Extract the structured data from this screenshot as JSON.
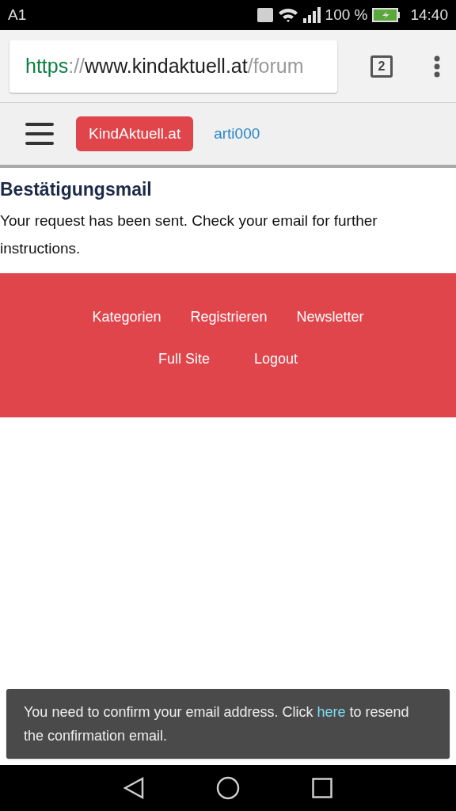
{
  "status_bar": {
    "carrier": "A1",
    "battery": "100 %",
    "time": "14:40"
  },
  "browser": {
    "url": {
      "scheme": "https",
      "separator": "://",
      "host": "www.kindaktuell.at",
      "path": "/forum"
    },
    "tab_count": "2"
  },
  "site_nav": {
    "logo": "KindAktuell.at",
    "user": "arti000"
  },
  "content": {
    "title": "Bestätigungsmail",
    "message": "Your request has been sent. Check your email for further instructions."
  },
  "footer": {
    "rows": [
      [
        "Kategorien",
        "Registrieren",
        "Newsletter"
      ],
      [
        "Full Site",
        "Logout"
      ]
    ]
  },
  "snackbar": {
    "before": "You need to confirm your email address. Click ",
    "link": "here",
    "after": " to resend the confirmation email."
  }
}
